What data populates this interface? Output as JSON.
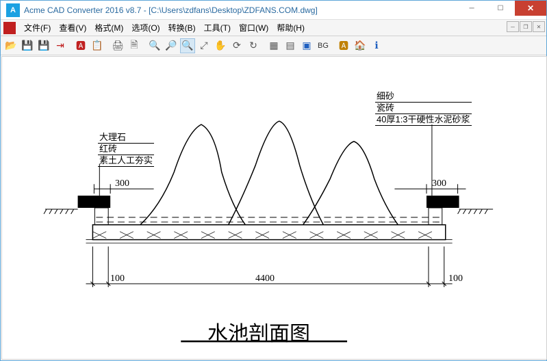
{
  "window": {
    "title": "Acme CAD Converter 2016 v8.7 - [C:\\Users\\zdfans\\Desktop\\ZDFANS.COM.dwg]"
  },
  "menu": {
    "file": "文件(F)",
    "view": "查看(V)",
    "format": "格式(M)",
    "options": "选项(O)",
    "convert": "转换(B)",
    "tools": "工具(T)",
    "window": "窗口(W)",
    "help": "帮助(H)"
  },
  "toolbar": {
    "bg_label": "BG"
  },
  "drawing": {
    "left_labels": {
      "l1": "大理石",
      "l2": "红砖",
      "l3": "素土人工夯实"
    },
    "right_labels": {
      "l1": "细砂",
      "l2": "瓷砖",
      "l3": "40厚1:3干硬性水泥砂浆"
    },
    "dims": {
      "left_top": "300",
      "right_top": "300",
      "bottom_left": "100",
      "bottom_center": "4400",
      "bottom_right": "100"
    },
    "title": "水池剖面图"
  }
}
